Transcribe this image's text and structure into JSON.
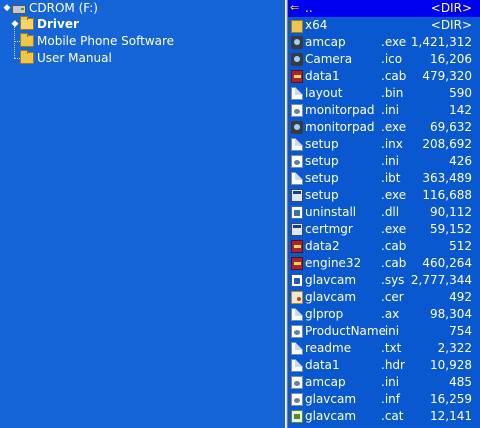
{
  "tree": {
    "items": [
      {
        "label": "CDROM (F:)",
        "icon": "cdrom-drive-icon",
        "level": 0,
        "expander": "◆"
      },
      {
        "label": "Driver",
        "icon": "folder-open-icon",
        "level": 1,
        "expander": "◆",
        "selected": true
      },
      {
        "label": "Mobile Phone Software",
        "icon": "folder-icon",
        "level": 1
      },
      {
        "label": "User Manual",
        "icon": "folder-icon",
        "level": 1
      }
    ]
  },
  "files": [
    {
      "name": "..",
      "ext": "",
      "size": "<DIR>",
      "icon": "parent-dir-icon",
      "type": "up"
    },
    {
      "name": "x64",
      "ext": "",
      "size": "<DIR>",
      "icon": "folder-icon",
      "type": "dir"
    },
    {
      "name": "amcap",
      "ext": ".exe",
      "size": "1,421,312",
      "icon": "camera-app-icon",
      "type": "cam"
    },
    {
      "name": "Camera",
      "ext": ".ico",
      "size": "16,206",
      "icon": "camera-icon",
      "type": "cam"
    },
    {
      "name": "data1",
      "ext": ".cab",
      "size": "479,320",
      "icon": "cabinet-icon",
      "type": "cab"
    },
    {
      "name": "layout",
      "ext": ".bin",
      "size": "590",
      "icon": "document-icon",
      "type": "doc"
    },
    {
      "name": "monitorpad",
      "ext": ".ini",
      "size": "142",
      "icon": "settings-file-icon",
      "type": "ini"
    },
    {
      "name": "monitorpad",
      "ext": ".exe",
      "size": "69,632",
      "icon": "application-icon",
      "type": "cam"
    },
    {
      "name": "setup",
      "ext": ".inx",
      "size": "208,692",
      "icon": "document-icon",
      "type": "doc"
    },
    {
      "name": "setup",
      "ext": ".ini",
      "size": "426",
      "icon": "settings-file-icon",
      "type": "ini"
    },
    {
      "name": "setup",
      "ext": ".ibt",
      "size": "363,489",
      "icon": "document-icon",
      "type": "doc"
    },
    {
      "name": "setup",
      "ext": ".exe",
      "size": "116,688",
      "icon": "installer-icon",
      "type": "exe"
    },
    {
      "name": "uninstall",
      "ext": ".dll",
      "size": "90,112",
      "icon": "library-icon",
      "type": "dll"
    },
    {
      "name": "certmgr",
      "ext": ".exe",
      "size": "59,152",
      "icon": "application-icon",
      "type": "exe"
    },
    {
      "name": "data2",
      "ext": ".cab",
      "size": "512",
      "icon": "cabinet-icon",
      "type": "cab"
    },
    {
      "name": "engine32",
      "ext": ".cab",
      "size": "460,264",
      "icon": "cabinet-icon",
      "type": "cab"
    },
    {
      "name": "glavcam",
      "ext": ".sys",
      "size": "2,777,344",
      "icon": "system-file-icon",
      "type": "sys"
    },
    {
      "name": "glavcam",
      "ext": ".cer",
      "size": "492",
      "icon": "certificate-icon",
      "type": "cer"
    },
    {
      "name": "glprop",
      "ext": ".ax",
      "size": "98,304",
      "icon": "document-icon",
      "type": "doc"
    },
    {
      "name": "ProductName",
      "ext": ".ini",
      "size": "754",
      "icon": "settings-file-icon",
      "type": "ini"
    },
    {
      "name": "readme",
      "ext": ".txt",
      "size": "2,322",
      "icon": "document-icon",
      "type": "doc"
    },
    {
      "name": "data1",
      "ext": ".hdr",
      "size": "10,928",
      "icon": "document-icon",
      "type": "doc"
    },
    {
      "name": "amcap",
      "ext": ".ini",
      "size": "485",
      "icon": "settings-file-icon",
      "type": "ini"
    },
    {
      "name": "glavcam",
      "ext": ".inf",
      "size": "16,259",
      "icon": "settings-file-icon",
      "type": "ini"
    },
    {
      "name": "glavcam",
      "ext": ".cat",
      "size": "12,141",
      "icon": "catalog-icon",
      "type": "cat"
    }
  ],
  "colors": {
    "pane_background": "#1565d8",
    "list_background": "#0a58d0",
    "selection": "#0000f0",
    "text": "#ffffff"
  }
}
